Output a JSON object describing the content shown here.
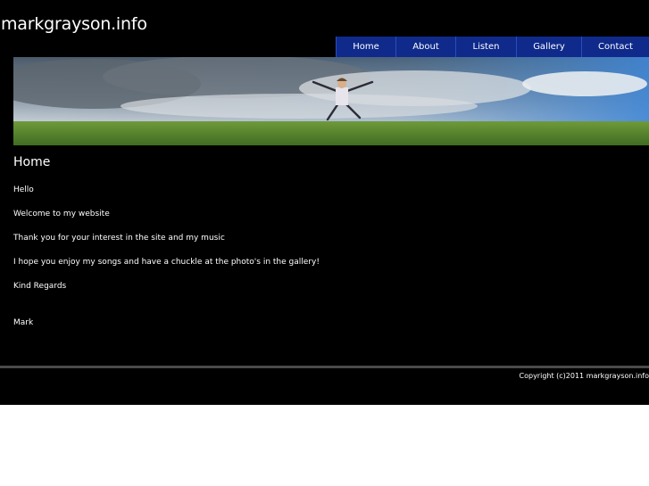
{
  "site": {
    "title": "markgrayson.info"
  },
  "nav": {
    "items": [
      {
        "label": "Home"
      },
      {
        "label": "About"
      },
      {
        "label": "Listen"
      },
      {
        "label": "Gallery"
      },
      {
        "label": "Contact"
      }
    ]
  },
  "page": {
    "heading": "Home",
    "lines": [
      "Hello",
      "Welcome to my website",
      "Thank you for your interest in the site and my music",
      "I hope you enjoy my songs and have a chuckle at the photo's in the gallery!",
      "Kind Regards",
      "Mark"
    ]
  },
  "footer": {
    "copyright": "Copyright (c)2011 markgrayson.info"
  },
  "colors": {
    "background": "#000000",
    "nav_background": "#0f2a8a",
    "text": "#ffffff",
    "divider": "#4a4a4a"
  }
}
